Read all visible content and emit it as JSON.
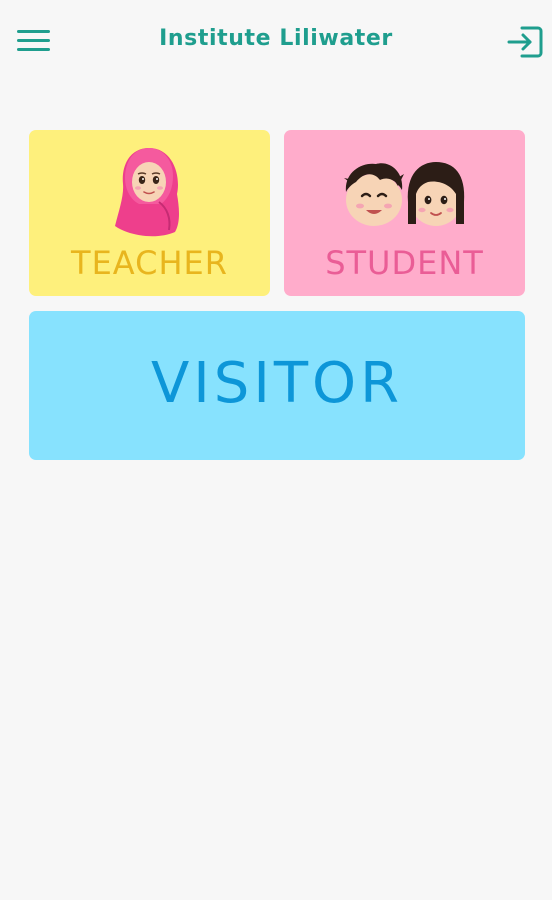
{
  "header": {
    "title": "Institute Liliwater",
    "menu_icon": "hamburger-menu-icon",
    "login_icon": "sign-in-icon",
    "accent_color": "#1f9e8e"
  },
  "roles": [
    {
      "label": "TEACHER",
      "illustration": "teacher-hijab-icon",
      "background": "#fef07c",
      "text_color": "#e8b51e"
    },
    {
      "label": "STUDENT",
      "illustration": "students-icon",
      "background": "#ffaccb",
      "text_color": "#ea5d96"
    },
    {
      "label": "VISITOR",
      "background": "#87e2fe",
      "text_color": "#0d96d8"
    }
  ]
}
